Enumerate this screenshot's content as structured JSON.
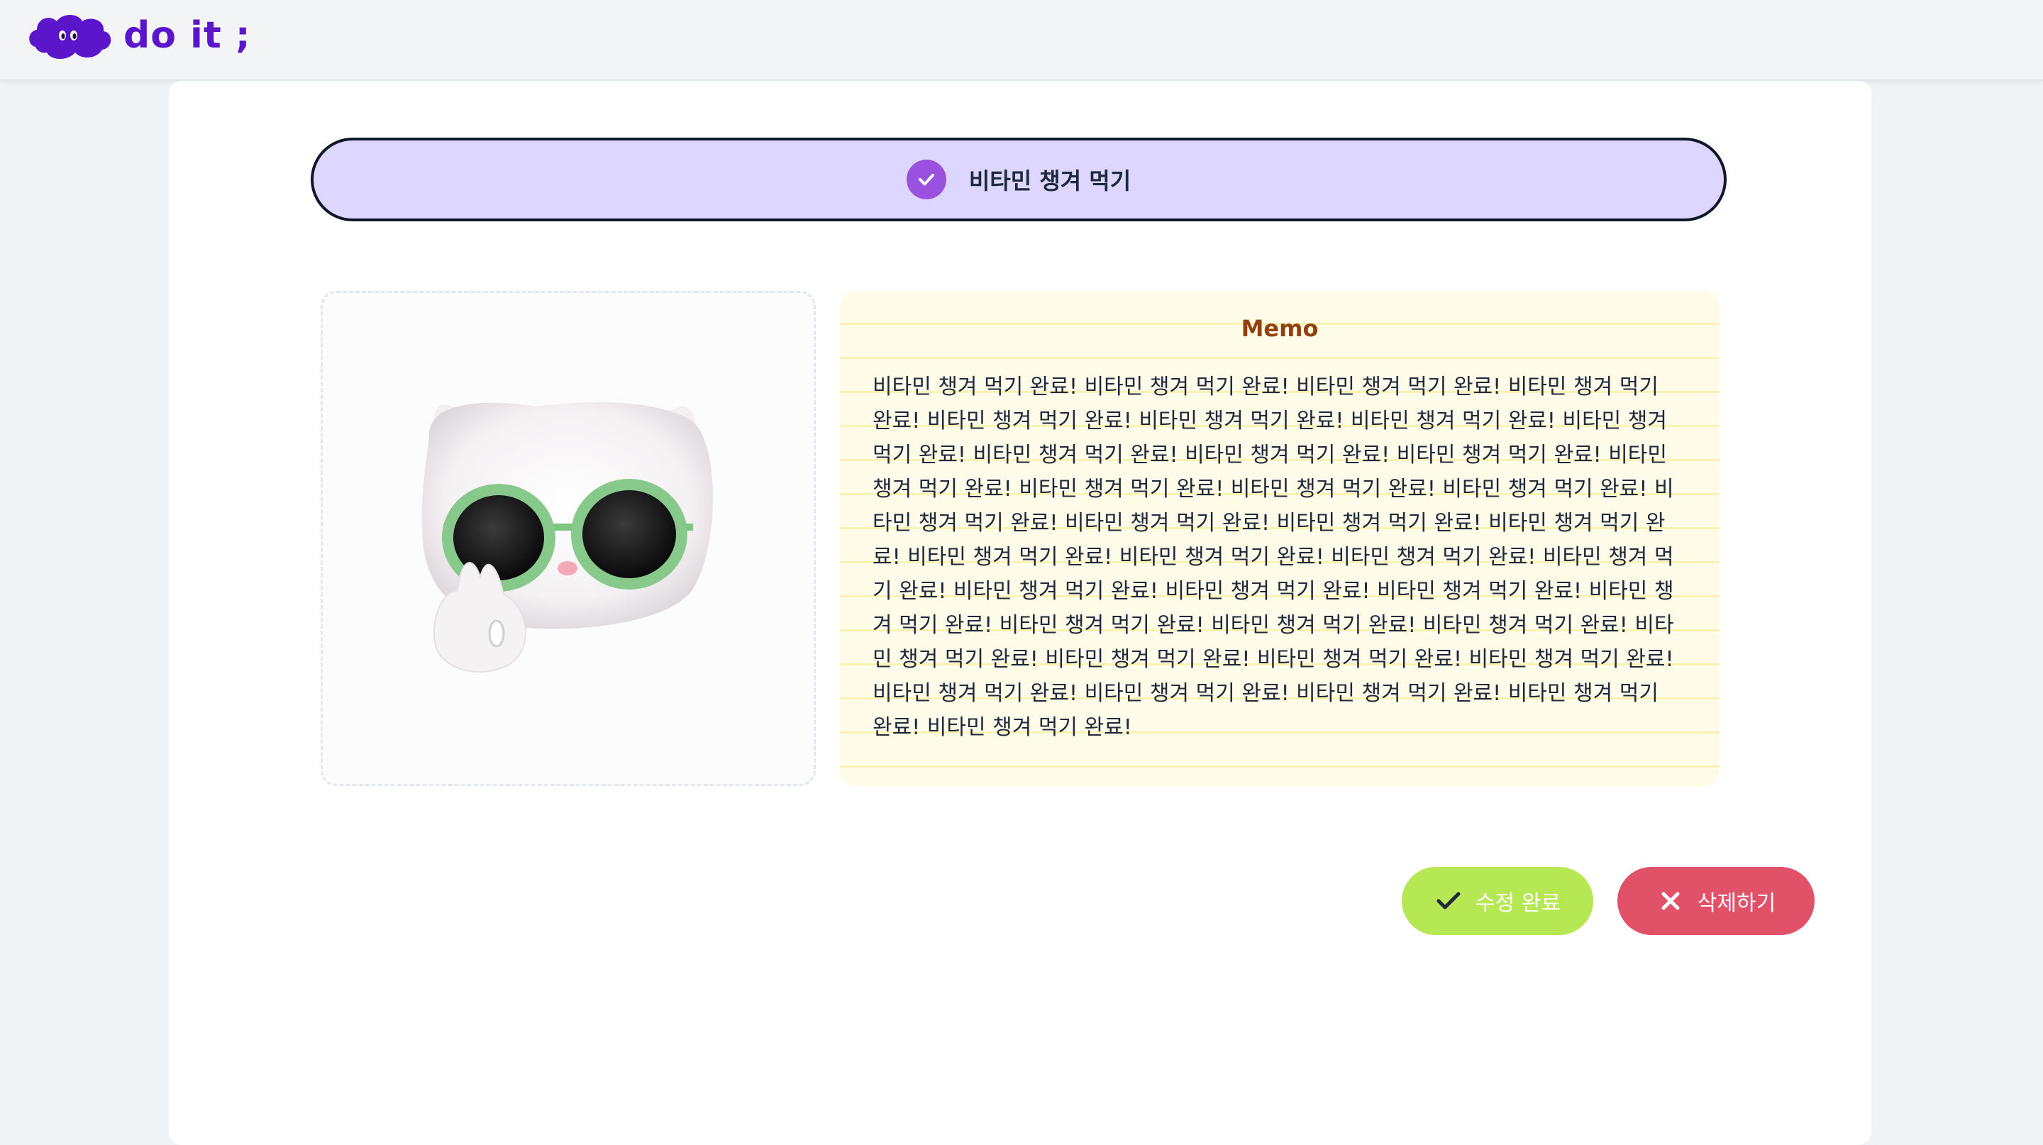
{
  "header": {
    "logo_text": "do it ;",
    "brand_color": "#5b16cc"
  },
  "todo": {
    "title": "비타민 챙겨 먹기",
    "completed": true,
    "check_color": "#9b51e0",
    "bg_color": "#ddd6fe"
  },
  "image": {
    "alt": "cat-with-green-sunglasses-icon"
  },
  "memo": {
    "title": "Memo",
    "body": "비타민 챙겨 먹기 완료! 비타민 챙겨 먹기 완료! 비타민 챙겨 먹기 완료! 비타민 챙겨 먹기 완료! 비타민 챙겨 먹기 완료! 비타민 챙겨 먹기 완료! 비타민 챙겨 먹기 완료! 비타민 챙겨 먹기 완료! 비타민 챙겨 먹기 완료! 비타민 챙겨 먹기 완료! 비타민 챙겨 먹기 완료! 비타민 챙겨 먹기 완료! 비타민 챙겨 먹기 완료! 비타민 챙겨 먹기 완료! 비타민 챙겨 먹기 완료! 비타민 챙겨 먹기 완료! 비타민 챙겨 먹기 완료! 비타민 챙겨 먹기 완료! 비타민 챙겨 먹기 완료! 비타민 챙겨 먹기 완료! 비타민 챙겨 먹기 완료! 비타민 챙겨 먹기 완료! 비타민 챙겨 먹기 완료! 비타민 챙겨 먹기 완료! 비타민 챙겨 먹기 완료! 비타민 챙겨 먹기 완료! 비타민 챙겨 먹기 완료! 비타민 챙겨 먹기 완료! 비타민 챙겨 먹기 완료! 비타민 챙겨 먹기 완료! 비타민 챙겨 먹기 완료! 비타민 챙겨 먹기 완료! 비타민 챙겨 먹기 완료! 비타민 챙겨 먹기 완료! 비타민 챙겨 먹기 완료! 비타민 챙겨 먹기 완료! 비타민 챙겨 먹기 완료! 비타민 챙겨 먹기 완료! 비타민 챙겨 먹기 완료!",
    "title_color": "#92400e",
    "bg_color": "#fefce8"
  },
  "actions": {
    "done_label": "수정 완료",
    "done_color": "#b5e853",
    "delete_label": "삭제하기",
    "delete_color": "#e15167"
  }
}
